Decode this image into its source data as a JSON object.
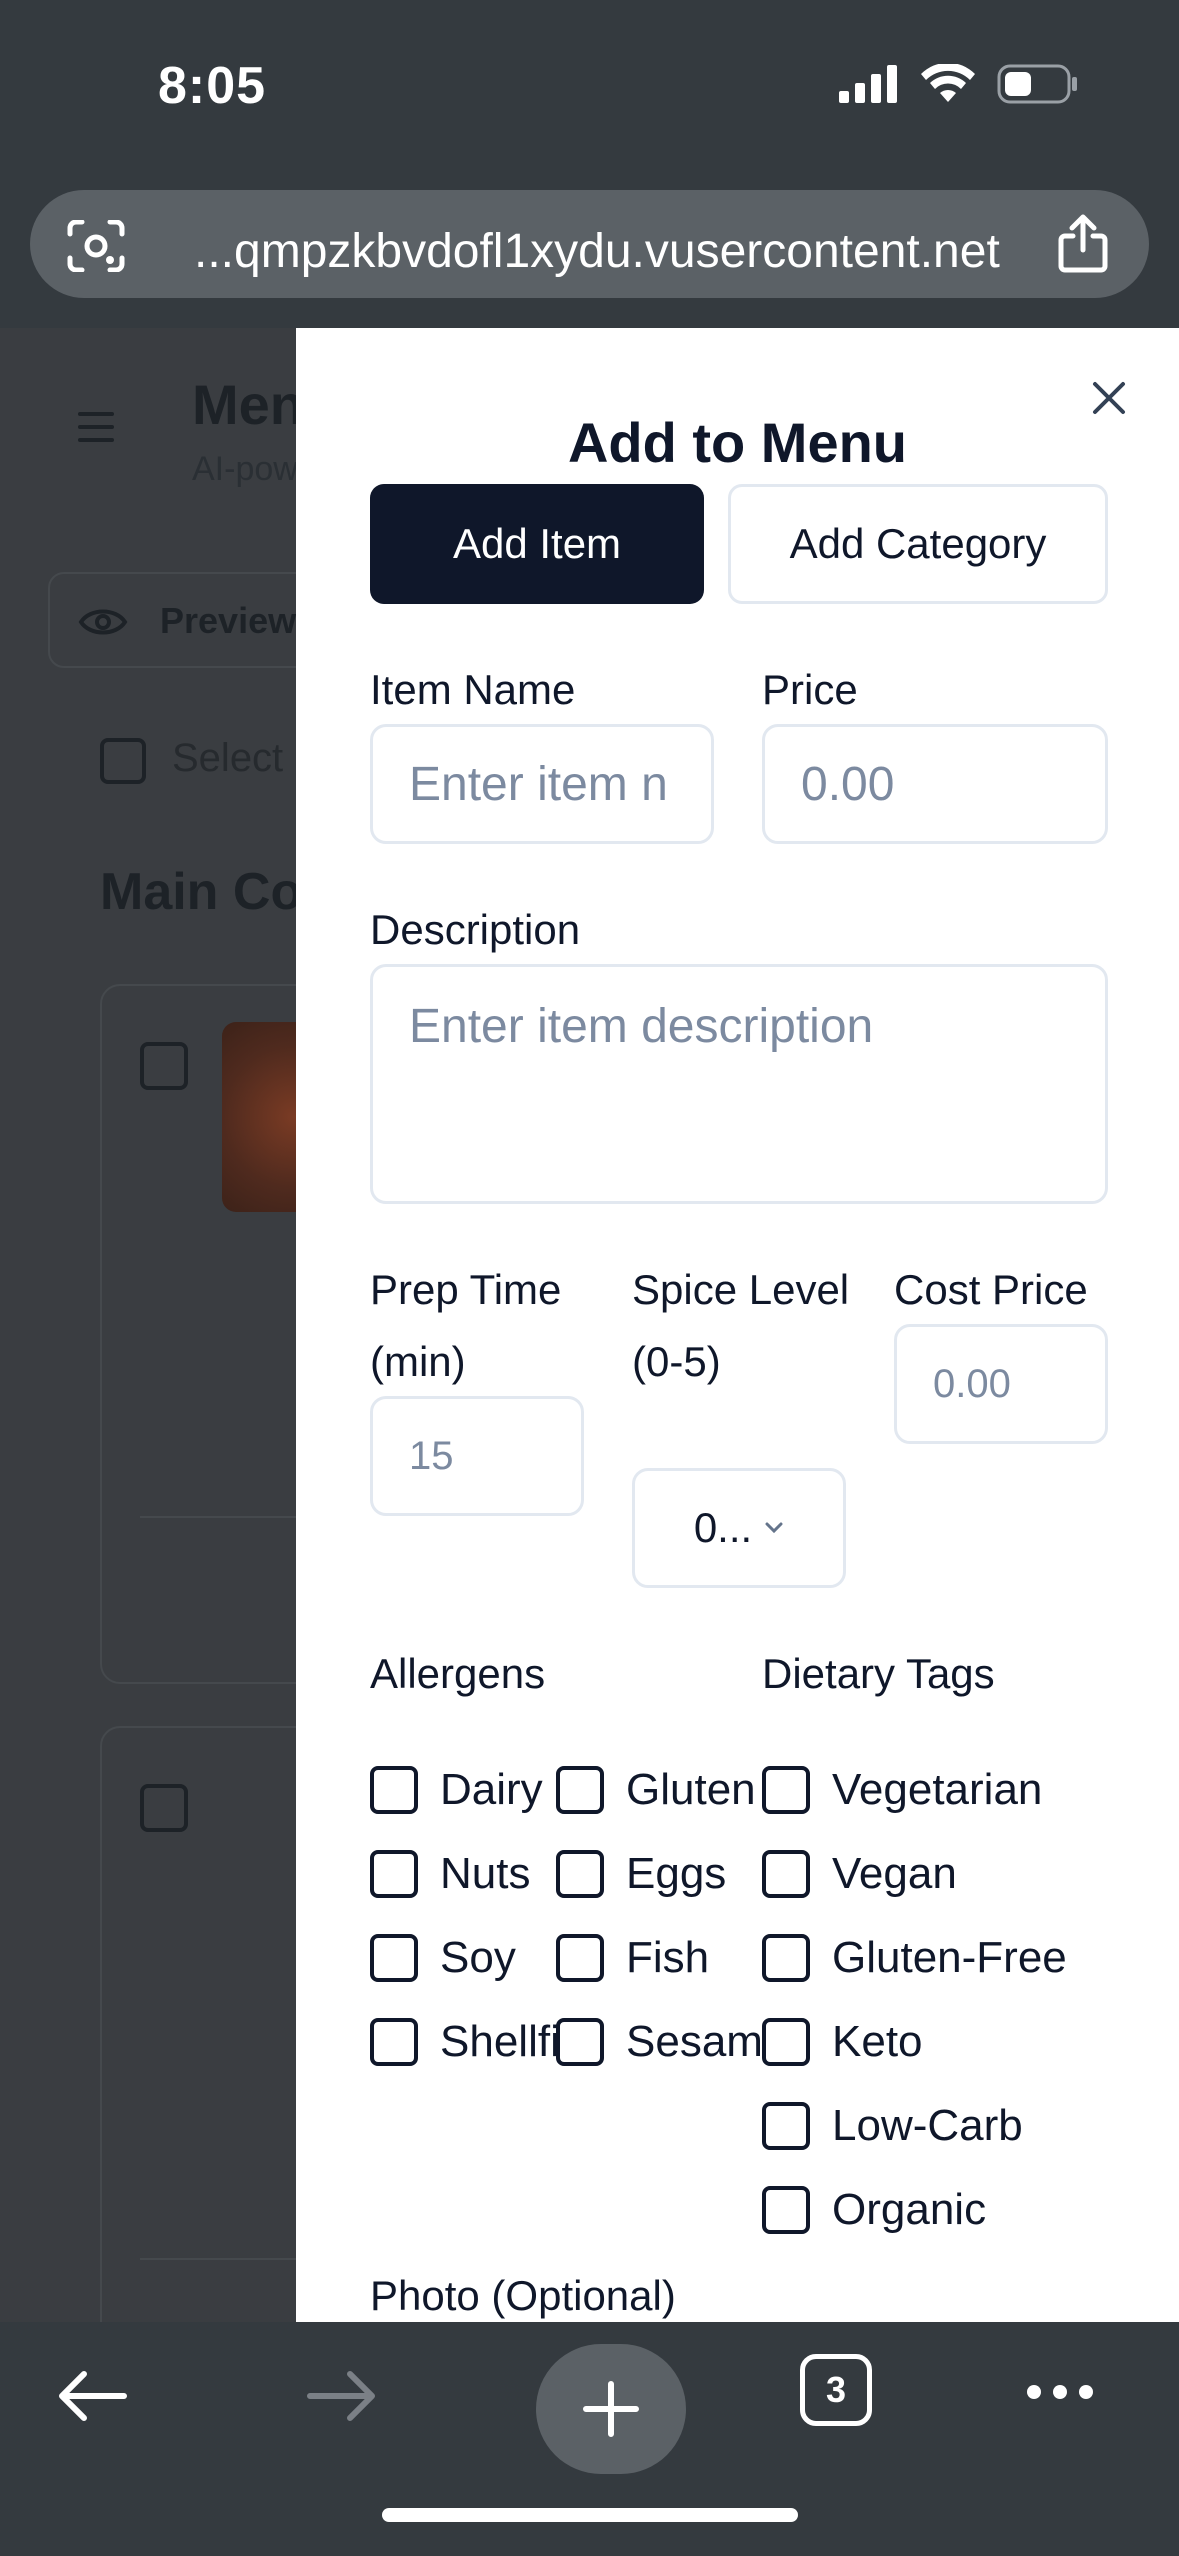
{
  "status_bar": {
    "time": "8:05"
  },
  "browser": {
    "url": "...qmpzkbvdofl1xydu.vusercontent.net",
    "tab_count": "3"
  },
  "background_page": {
    "title": "Men",
    "subtitle": "AI-pow",
    "preview_label": "Preview",
    "select_label": "Select",
    "section_title": "Main Co"
  },
  "modal": {
    "title": "Add to Menu",
    "close_glyph": "×",
    "tabs": [
      {
        "label": "Add Item",
        "active": true
      },
      {
        "label": "Add Category",
        "active": false
      }
    ],
    "item_name": {
      "label": "Item Name",
      "placeholder": "Enter item n",
      "value": ""
    },
    "price": {
      "label": "Price",
      "placeholder": "0.00",
      "value": ""
    },
    "description": {
      "label": "Description",
      "placeholder": "Enter item description",
      "value": ""
    },
    "prep_time": {
      "label": "Prep Time (min)",
      "placeholder": "15",
      "value": ""
    },
    "spice_level": {
      "label": "Spice Level (0-5)",
      "selected": "0..."
    },
    "cost_price": {
      "label": "Cost Price",
      "placeholder": "0.00",
      "value": ""
    },
    "allergens": {
      "label": "Allergens",
      "items": [
        "Dairy",
        "Gluten",
        "Nuts",
        "Eggs",
        "Soy",
        "Fish",
        "Shellfish",
        "Sesame"
      ]
    },
    "dietary_tags": {
      "label": "Dietary Tags",
      "items": [
        "Vegetarian",
        "Vegan",
        "Gluten-Free",
        "Keto",
        "Low-Carb",
        "Organic"
      ]
    },
    "photo_label": "Photo (Optional)"
  },
  "colors": {
    "primary": "#0f172a",
    "border": "#e2e8f0",
    "placeholder": "#7c8aa0",
    "chrome": "#343a3f"
  }
}
